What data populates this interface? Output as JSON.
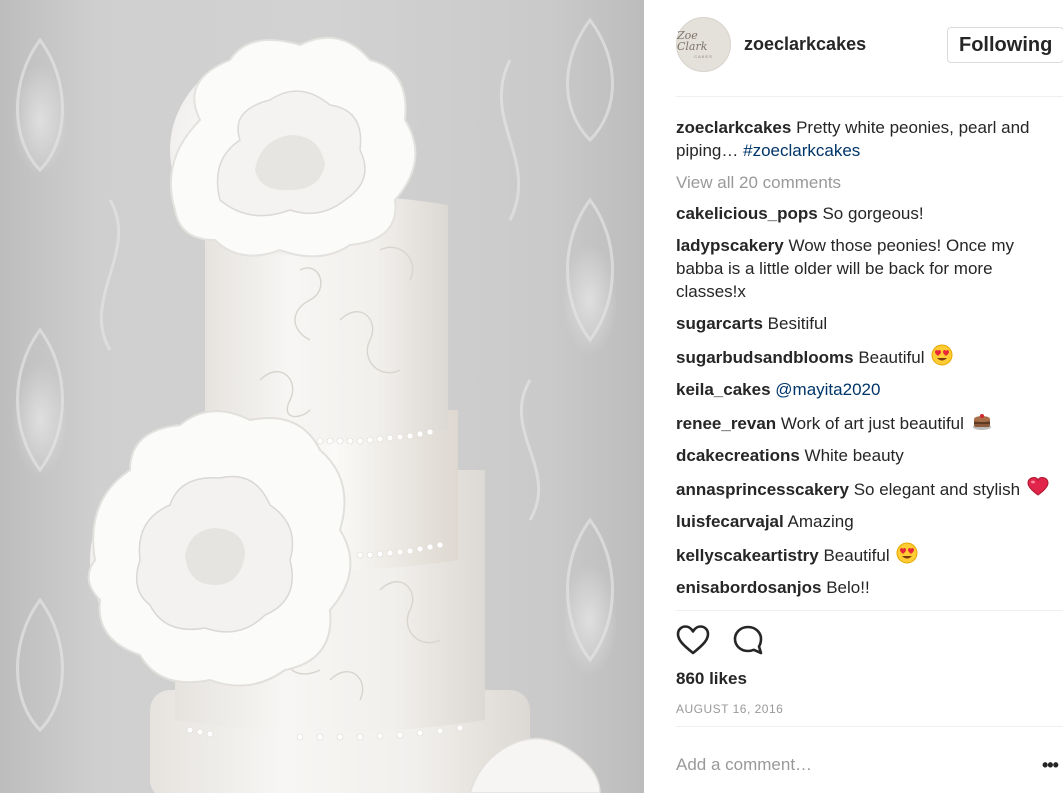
{
  "post": {
    "username": "zoeclarkcakes",
    "avatar_text": "Zoe Clark",
    "avatar_subtext": "CAKES",
    "follow_label": "Following",
    "caption": {
      "author": "zoeclarkcakes",
      "text": "Pretty white peonies, pearl and piping…",
      "hashtag": "#zoeclarkcakes"
    },
    "view_all_label": "View all 20 comments",
    "comments": [
      {
        "user": "cakelicious_pops",
        "text": "So gorgeous!"
      },
      {
        "user": "ladypscakery",
        "text": "Wow those peonies! Once my babba is a little older will be back for more classes!x"
      },
      {
        "user": "sugarcarts",
        "text": "Besitiful"
      },
      {
        "user": "sugarbudsandblooms",
        "text": "Beautiful",
        "emoji": "heart-eyes-icon"
      },
      {
        "user": "keila_cakes",
        "mention": "@mayita2020"
      },
      {
        "user": "renee_revan",
        "text": "Work of art just beautiful",
        "emoji": "cake-icon"
      },
      {
        "user": "dcakecreations",
        "text": "White beauty"
      },
      {
        "user": "annasprincesscakery",
        "text": "So elegant and stylish",
        "emoji": "heart-icon"
      },
      {
        "user": "luisfecarvajal",
        "text": "Amazing"
      },
      {
        "user": "kellyscakeartistry",
        "text": "Beautiful",
        "emoji": "heart-eyes-icon"
      },
      {
        "user": "enisabordosanjos",
        "text": "Belo!!"
      }
    ],
    "likes": "860 likes",
    "date": "AUGUST 16, 2016",
    "add_comment_placeholder": "Add a comment…",
    "more_label": "•••"
  },
  "colors": {
    "text": "#262626",
    "muted": "#999999",
    "link": "#003569",
    "border": "#dbdbdb"
  }
}
